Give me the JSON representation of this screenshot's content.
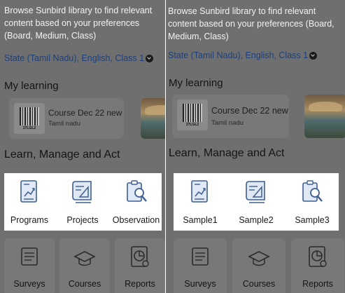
{
  "left": {
    "intro_text": "Browse Sunbird library to find relevant content based on your preferences (Board, Medium, Class)",
    "preferences": "State (Tamil Nadu), English, Class 1",
    "my_learning_title": "My learning",
    "course": {
      "title": "Course Dec 22 new",
      "subtitle": "Tamil nadu",
      "qr_code": "27LGL2"
    },
    "section_title": "Learn, Manage and Act",
    "tiles": [
      "Programs",
      "Projects",
      "Observation"
    ],
    "bottom_tiles": [
      "Surveys",
      "Courses",
      "Reports"
    ]
  },
  "right": {
    "intro_text": "Browse Sunbird library to find relevant content based on your preferences (Board, Medium, Class)",
    "preferences": "State (Tamil Nadu), English, Class 1",
    "my_learning_title": "My learning",
    "course": {
      "title": "Course Dec 22 new",
      "subtitle": "Tamil nadu",
      "qr_code": "27LGL2"
    },
    "section_title": "Learn, Manage and Act",
    "tiles": [
      "Sample1",
      "Sample2",
      "Sample3"
    ],
    "bottom_tiles": [
      "Surveys",
      "Courses",
      "Reports"
    ]
  },
  "icons": {
    "tile_icons": [
      "programs-document-icon",
      "projects-blueprint-icon",
      "observation-magnifier-icon"
    ],
    "bottom_icons": [
      "surveys-clipboard-icon",
      "courses-graduation-cap-icon",
      "reports-chart-icon"
    ],
    "preferences_icon": "chevron-down-circle-icon"
  },
  "colors": {
    "overlay": "#6f6f6f",
    "highlight": "#ffffff",
    "link": "#1c3f7a",
    "icon_stroke": "#3e5f8f",
    "icon_fill": "#dfe8f4"
  }
}
